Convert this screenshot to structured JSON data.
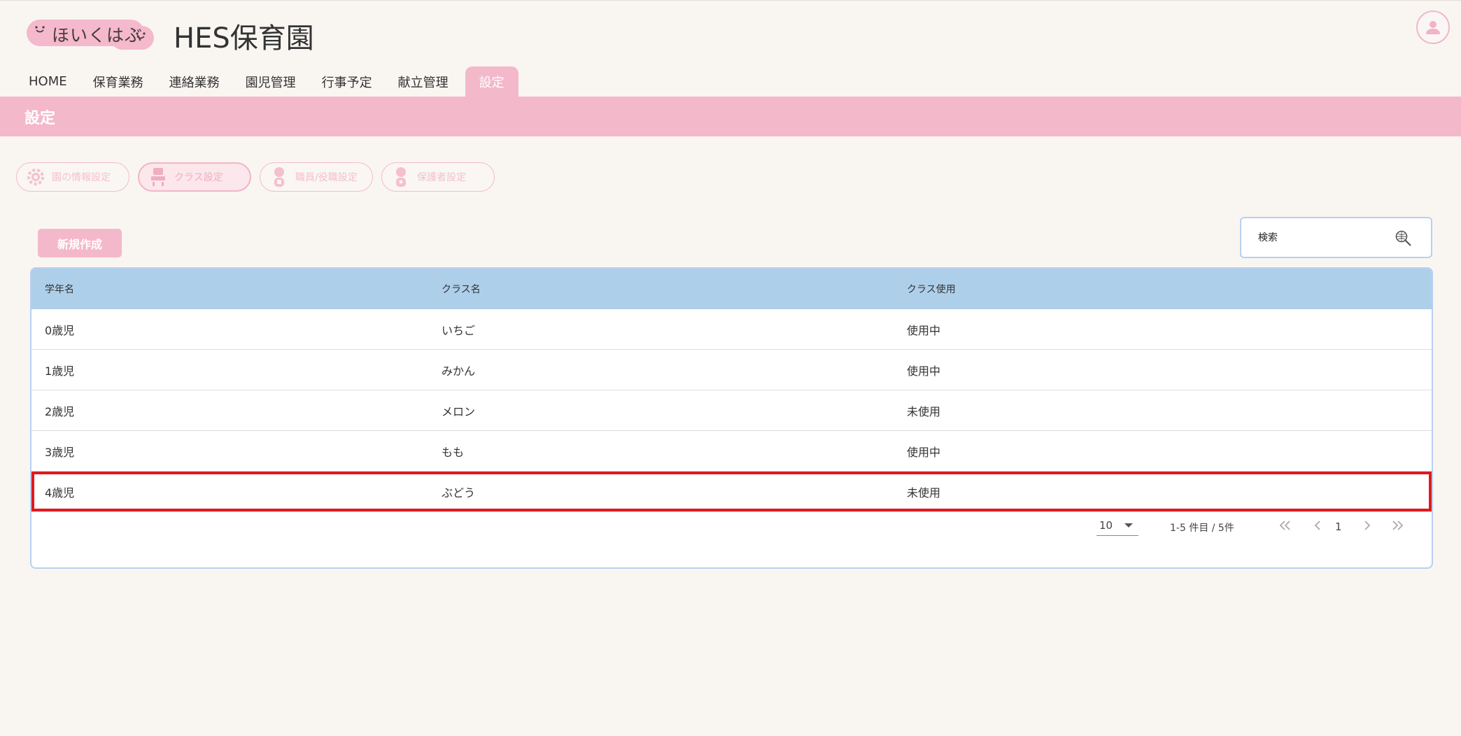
{
  "header": {
    "logo_text": "ほいくはぶ",
    "site_title": "HES保育園",
    "avatar_icon": "user-icon"
  },
  "nav": {
    "items": [
      {
        "label": "HOME"
      },
      {
        "label": "保育業務"
      },
      {
        "label": "連絡業務"
      },
      {
        "label": "園児管理"
      },
      {
        "label": "行事予定"
      },
      {
        "label": "献立管理"
      },
      {
        "label": "設定",
        "active": true
      }
    ]
  },
  "page": {
    "title": "設定"
  },
  "subtabs": [
    {
      "label": "園の情報設定",
      "icon": "gear-icon"
    },
    {
      "label": "クラス設定",
      "icon": "classroom-icon",
      "active": true
    },
    {
      "label": "職員/役職設定",
      "icon": "staff-icon"
    },
    {
      "label": "保護者設定",
      "icon": "guardian-icon"
    }
  ],
  "toolbar": {
    "new_label": "新規作成",
    "search_placeholder": "検索",
    "search_icon": "search-icon"
  },
  "table": {
    "headers": [
      "学年名",
      "クラス名",
      "クラス使用"
    ],
    "rows": [
      [
        "0歳児",
        "いちご",
        "使用中"
      ],
      [
        "1歳児",
        "みかん",
        "使用中"
      ],
      [
        "2歳児",
        "メロン",
        "未使用"
      ],
      [
        "3歳児",
        "もも",
        "使用中"
      ],
      [
        "4歳児",
        "ぶどう",
        "未使用"
      ]
    ]
  },
  "pagination": {
    "per_page": "10",
    "range": "1-5 件目 / 5件",
    "current_page": "1"
  },
  "colors": {
    "brand_pink": "#f4b8cb",
    "table_header": "#aecfea",
    "highlight_border": "#e0191e"
  }
}
